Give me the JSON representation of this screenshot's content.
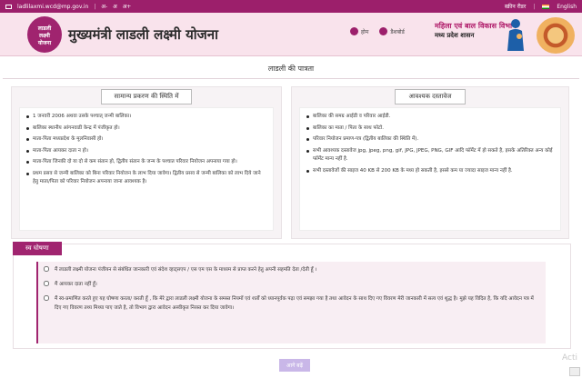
{
  "topbar": {
    "email": "ladlilaxmi.wcd@mp.gov.in",
    "font_small": "अ-",
    "font_normal": "अ",
    "font_large": "अ+",
    "screen_reader": "स्क्रीन रीडर",
    "language": "English"
  },
  "header": {
    "logo_line1": "लाडली",
    "logo_line2": "लक्ष्मी",
    "logo_line3": "योजना",
    "title": "मुख्यमंत्री लाडली लक्ष्मी योजना",
    "nav_home": "होम",
    "nav_dashboard": "डैशबोर्ड",
    "dept_line1": "महिला एवं बाल विकास विभाग",
    "dept_line2": "मध्य प्रदेश शासन"
  },
  "page": {
    "heading": "लाडली की पात्रता"
  },
  "left_panel": {
    "title": "सामान्य प्रकरण की स्थिति में",
    "items": [
      "1 जनवरी 2006 अथवा उसके पश्चात् जन्मी बालिका।",
      "बालिका स्थानीय आंगनवाडी केन्द्र में पंजीकृत हो।",
      "माता-पिता मध्यप्रदेश के मूलनिवासी हो।",
      "माता-पिता आयकर दाता न हो।",
      "माता-पिता जिनकी दो या दो से कम संतान हो, द्वितीय संतान के जन्म के पश्चात परिवार नियोजन अपनाया गया हो।",
      "प्रथम प्रसव से जन्मी बालिका को बिना परिवार नियोजन के लाभ दिया जावेगा। द्वितीय प्रसव से जन्मी बालिका को लाभ दिये जाने हेतु माता/पिता को परिवार नियोजन अपनाया जाना आवश्यक है।"
    ]
  },
  "right_panel": {
    "title": "आवश्यक दस्तावेज",
    "items": [
      "बालिका की समग्र आईडी व परिवार आईडी.",
      "बालिका का माता / पिता के साथ फोटो.",
      "परिवार नियोजन प्रमाण-पत्र (द्वितीय बालिका की स्थिति में).",
      "सभी आवश्यक दस्तावेज jpg, jpeg, png, gif, JPG, JPEG, PNG, GIF आदि फॉर्मेट में हो सकते है, इसके अतिरिक्त अन्य कोई फॉर्मेट मान्य नहीं है.",
      "सभी दस्तावेजों की साइज 40 KB से 200 KB के मध्य हो सकती है, इससे कम या ज्यादा साइज मान्य नहीं है."
    ]
  },
  "declaration": {
    "title": "स्व घोषणा",
    "items": [
      "मैं लाडली लक्ष्मी योजना पंजीयन से संबंधित जानकारी एवं संदेश व्हाट्सएप / एस एम एस के माध्यम से प्राप्त करने हेतु अपनी सहमति देता /देती हूँ ।",
      "मैं आयकर दाता नहीं हूँ।",
      "मैं स्व-प्रमाणित करते हुए यह घोषणा करता/ करती हूँ , कि मेरे द्वारा लाडली लक्ष्मी योजना के समस्त नियमों एवं शर्तों को ध्यानपूर्वक पढ़ा एवं समझा गया है तथा आवेदन के साथ दिए गए विवरण मेरी जानकारी में सत्य एवं शुद्ध है। मुझे यह विदित है, कि यदि आवेदन पत्र में दिए गए विवरण तथ्य मिथ्या पाए जाते है, तो विभाग द्वारा आवेदन अस्वीकृत निरस्त कर दिया जावेगा।"
    ]
  },
  "footer": {
    "next_button": "आगे बढ़ें",
    "watermark": "Acti"
  }
}
